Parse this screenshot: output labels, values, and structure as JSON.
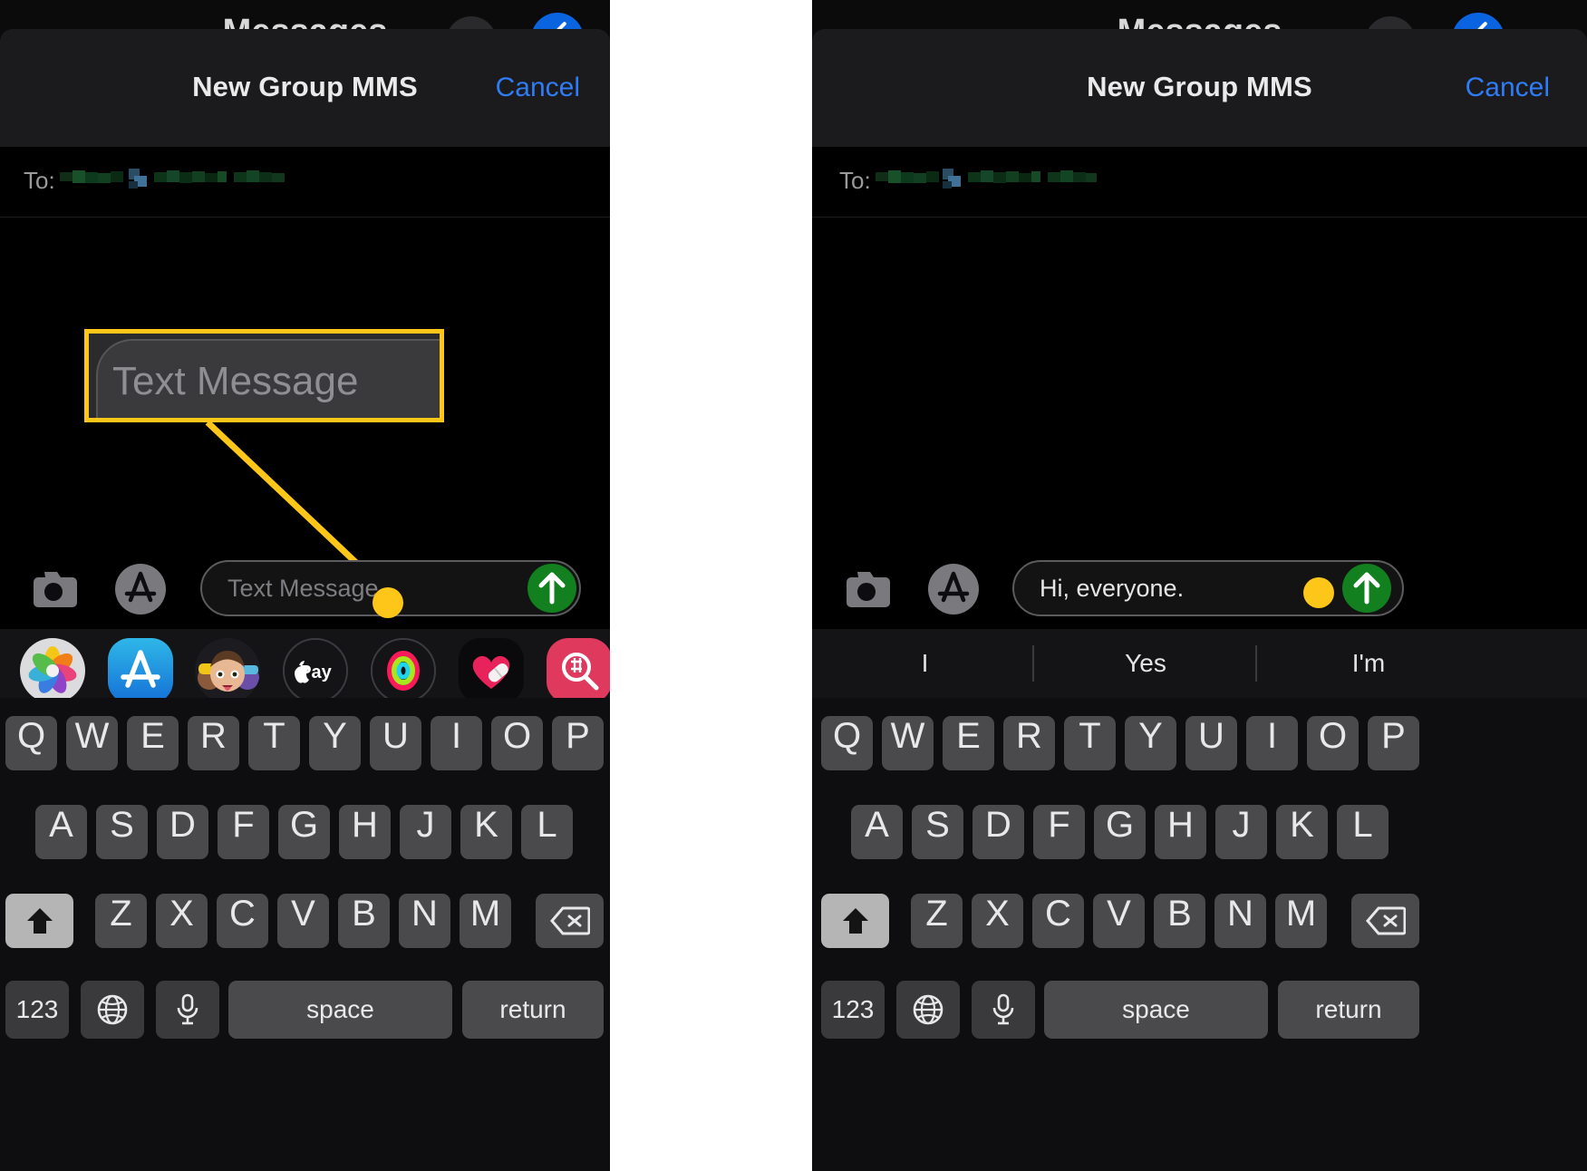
{
  "meta": {
    "accent_yellow": "#FFC61A",
    "send_green": "#12801f",
    "link_blue": "#2f7df6",
    "key_gray": "#4a4a4d",
    "key_dark": "#3a3a3d",
    "key_active": "#b5b5b5"
  },
  "background_app": {
    "title": "Messages",
    "avatar_icon": "avatar-circle-icon",
    "compose_icon": "compose-pencil-icon"
  },
  "panels": [
    {
      "id": "left",
      "header": {
        "title": "New Group MMS",
        "cancel_label": "Cancel"
      },
      "recipients": {
        "label": "To:",
        "value_redacted": true
      },
      "callout": {
        "type": "rectangle-zoom",
        "magnified_text": "Text Message",
        "target": "message-text-field"
      },
      "input_bar": {
        "camera_icon": "camera-icon",
        "appstore_icon": "app-store-icon",
        "field_placeholder": "Text Message",
        "field_value": "",
        "send_icon": "send-arrow-up-icon"
      },
      "app_drawer": [
        {
          "name": "photos-app-icon",
          "label": "Photos"
        },
        {
          "name": "app-store-app-icon",
          "label": "App Store"
        },
        {
          "name": "memoji-app-icon",
          "label": "Memoji Stickers"
        },
        {
          "name": "apple-pay-app-icon",
          "label": "Apple Pay"
        },
        {
          "name": "activity-rings-app-icon",
          "label": "Activity"
        },
        {
          "name": "health-app-icon",
          "label": "Health"
        },
        {
          "name": "images-search-app-icon",
          "label": "#images"
        }
      ],
      "predictive_bar": null
    },
    {
      "id": "right",
      "header": {
        "title": "New Group MMS",
        "cancel_label": "Cancel"
      },
      "recipients": {
        "label": "To:",
        "value_redacted": true
      },
      "callout": {
        "type": "circle-lens-zoom",
        "magnified_icon": "send-arrow-up-icon",
        "target": "send-button"
      },
      "input_bar": {
        "camera_icon": "camera-icon",
        "appstore_icon": "app-store-icon",
        "field_placeholder": "Text Message",
        "field_value": "Hi, everyone.",
        "send_icon": "send-arrow-up-icon"
      },
      "app_drawer": null,
      "predictive_bar": [
        "I",
        "Yes",
        "I'm"
      ]
    }
  ],
  "keyboard": {
    "row1": [
      "Q",
      "W",
      "E",
      "R",
      "T",
      "Y",
      "U",
      "I",
      "O",
      "P"
    ],
    "row2": [
      "A",
      "S",
      "D",
      "F",
      "G",
      "H",
      "J",
      "K",
      "L"
    ],
    "row3": [
      "Z",
      "X",
      "C",
      "V",
      "B",
      "N",
      "M"
    ],
    "shift_key": {
      "name": "shift-key",
      "icon": "shift-arrow-up-icon",
      "active": true
    },
    "backspace_key": {
      "name": "backspace-key",
      "icon": "backspace-icon"
    },
    "row4": {
      "numbers_label": "123",
      "globe_icon": "globe-icon",
      "mic_icon": "microphone-icon",
      "space_label": "space",
      "return_label": "return"
    }
  }
}
